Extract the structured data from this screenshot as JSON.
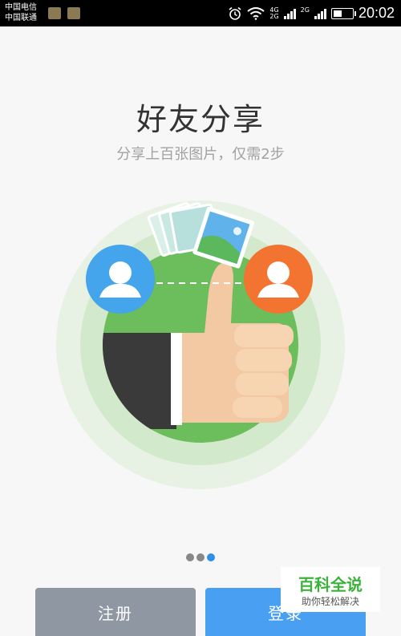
{
  "status_bar": {
    "carrier1": "中国电信",
    "carrier2": "中国联通",
    "net1": "4G",
    "net2": "2G",
    "net3": "2G",
    "time": "20:02",
    "battery_level": 0.45
  },
  "onboarding": {
    "title": "好友分享",
    "subtitle": "分享上百张图片，仅需2步",
    "page_count": 3,
    "active_page": 3
  },
  "buttons": {
    "register_label": "注册",
    "login_label": "登录"
  },
  "watermark": {
    "brand": "百科全说",
    "slogan": "助你轻松解决"
  },
  "colors": {
    "register_button": "#8f97a3",
    "login_button": "#49a0f2",
    "circle_green": "#6cbd5c",
    "avatar_blue": "#44a4ec",
    "avatar_orange": "#f37431"
  }
}
